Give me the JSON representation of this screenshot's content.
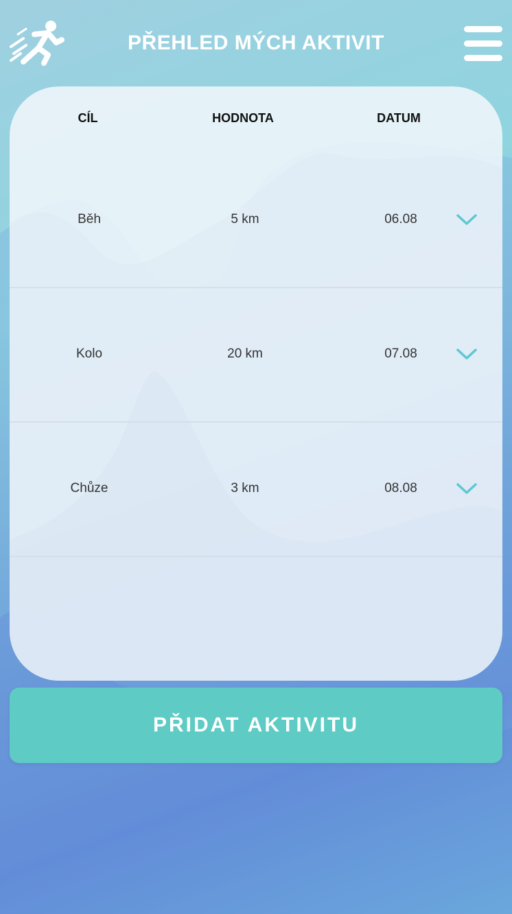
{
  "header": {
    "title": "PŘEHLED MÝCH AKTIVIT",
    "logo_icon": "runner-icon",
    "menu_icon": "hamburger-menu-icon"
  },
  "table": {
    "columns": [
      "CÍL",
      "HODNOTA",
      "DATUM"
    ],
    "rows": [
      {
        "goal": "Běh",
        "value": "5 km",
        "date": "06.08"
      },
      {
        "goal": "Kolo",
        "value": "20 km",
        "date": "07.08"
      },
      {
        "goal": "Chůze",
        "value": "3 km",
        "date": "08.08"
      }
    ],
    "expand_icon": "chevron-down-icon"
  },
  "actions": {
    "add_label": "PŘIDAT AKTIVITU"
  },
  "colors": {
    "accent": "#5ecbc5",
    "chevron": "#5ec8d0",
    "card": "#f0f6fa"
  }
}
